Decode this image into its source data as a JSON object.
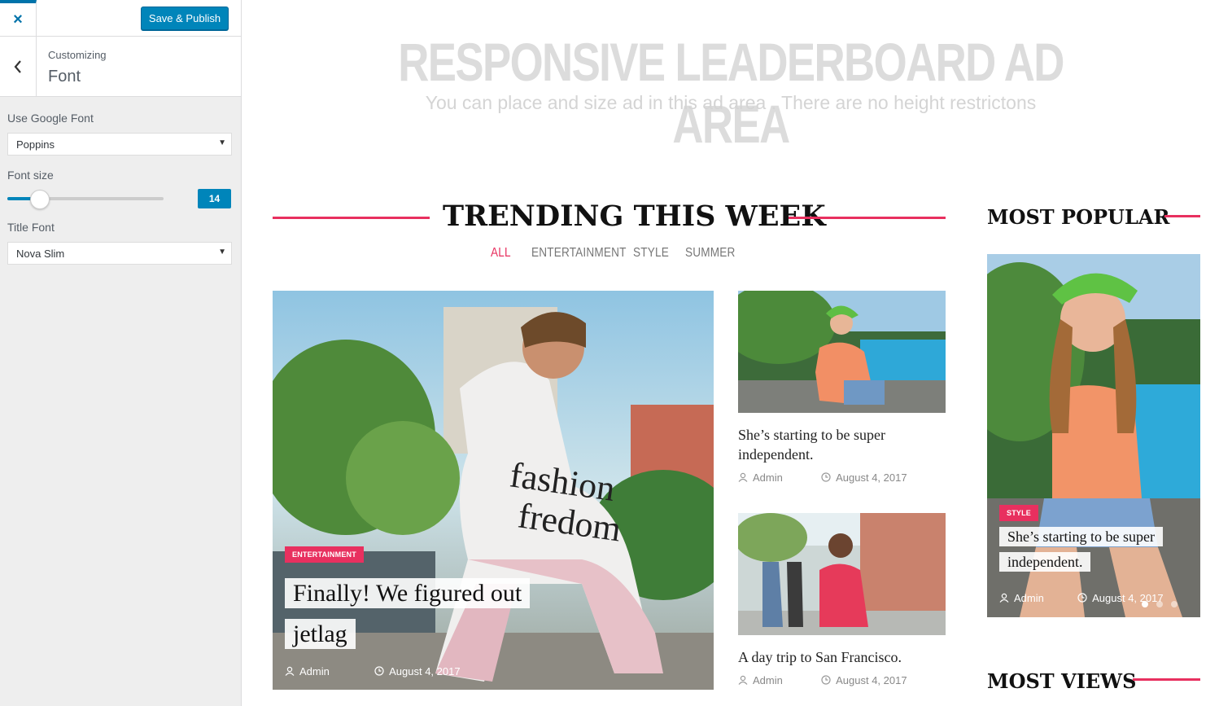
{
  "customizer": {
    "close_icon": "×",
    "save_label": "Save & Publish",
    "back_icon": "‹",
    "breadcrumb": "Customizing",
    "section_title": "Font",
    "google_font_label": "Use Google Font",
    "google_font_value": "Poppins",
    "font_size_label": "Font size",
    "font_size_value": "14",
    "font_size_fraction": 0.21,
    "title_font_label": "Title Font",
    "title_font_value": "Nova Slim",
    "dropdown_arrow": "▼",
    "accent_color": "#0085ba"
  },
  "preview": {
    "ad_title": "RESPONSIVE LEADERBOARD AD  AREA",
    "ad_subtitle": "You can place and size ad in this ad area . There are no height restrictons",
    "trending_title": "TRENDING THIS WEEK",
    "filters": [
      "ALL",
      "ENTERTAINMENT",
      "STYLE",
      "SUMMER"
    ],
    "accent_color": "#e8305f",
    "featured": {
      "category": "ENTERTAINMENT",
      "title_line1": "Finally! We figured out",
      "title_line2": "jetlag",
      "author": "Admin",
      "date": "August 4, 2017"
    },
    "cards": [
      {
        "title": "She’s starting to be super independent.",
        "author": "Admin",
        "date": "August 4, 2017"
      },
      {
        "title": "A day trip to San Francisco.",
        "author": "Admin",
        "date": "August 4, 2017"
      }
    ],
    "most_popular_title": "MOST POPULAR",
    "popular": {
      "category": "STYLE",
      "title_line1": "She’s starting to be super",
      "title_line2": "independent.",
      "author": "Admin",
      "date": "August 4, 2017"
    },
    "most_views_title": "MOST VIEWS",
    "icons": {
      "author": "user-icon",
      "date": "clock-icon"
    }
  }
}
